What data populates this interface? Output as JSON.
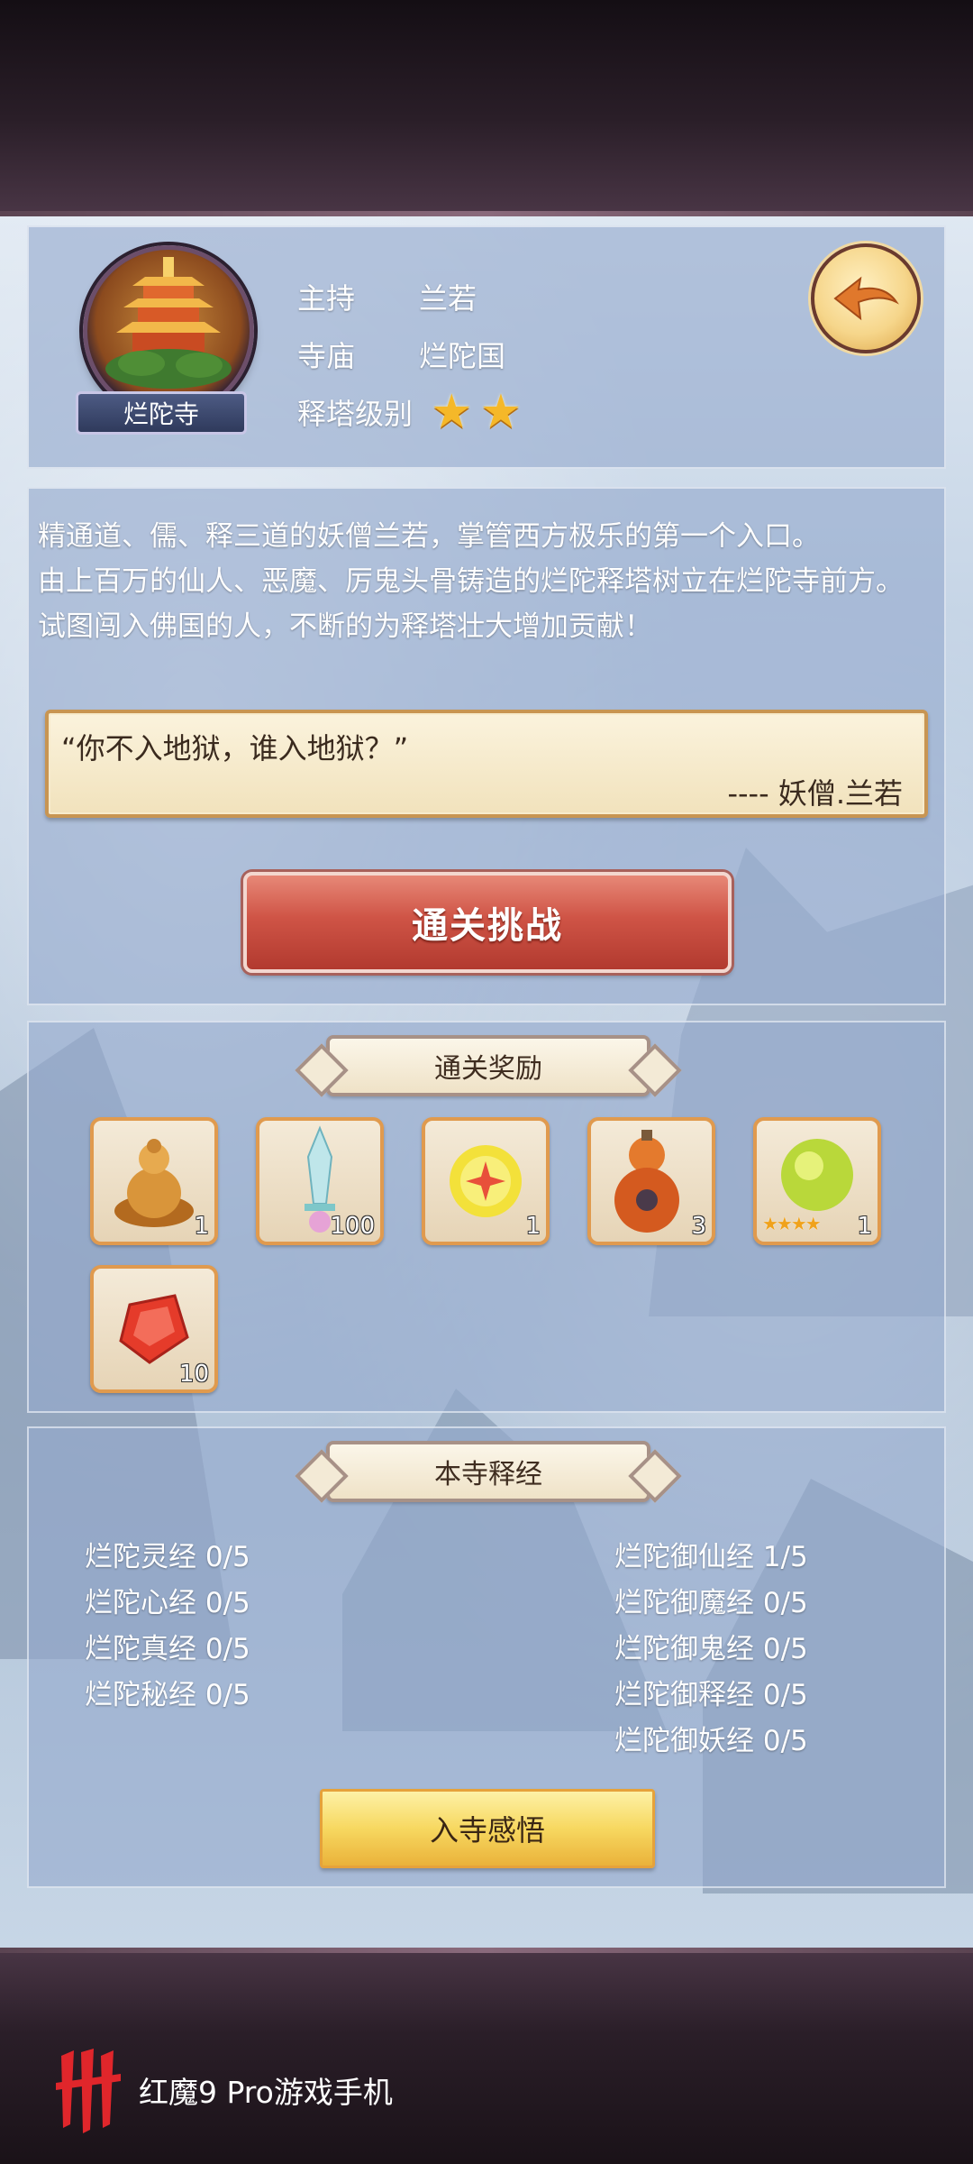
{
  "header": {
    "temple_badge": "烂陀寺",
    "rows": [
      {
        "label": "主持",
        "value": "兰若"
      },
      {
        "label": "寺庙",
        "value": "烂陀国"
      },
      {
        "label": "释塔级别",
        "value": ""
      }
    ],
    "tower_level_stars": 2,
    "back_icon": "back-arrow-icon"
  },
  "description": {
    "lines": [
      "精通道、儒、释三道的妖僧兰若，掌管西方极乐的第一个入口。",
      "由上百万的仙人、恶魔、厉鬼头骨铸造的烂陀释塔树立在烂陀寺前方。",
      "试图闯入佛国的人，不断的为释塔壮大增加贡献！"
    ],
    "quote": "“你不入地狱，谁入地狱？”",
    "quote_author": "---- 妖僧.兰若",
    "challenge_button": "通关挑战"
  },
  "rewards": {
    "title": "通关奖励",
    "items": [
      {
        "icon": "golden-buddha-icon",
        "count": "1"
      },
      {
        "icon": "jade-sword-icon",
        "count": "100"
      },
      {
        "icon": "golden-orb-icon",
        "count": "1"
      },
      {
        "icon": "gourd-icon",
        "count": "3"
      },
      {
        "icon": "green-orb-icon",
        "count": "1",
        "stars": 4
      },
      {
        "icon": "red-crystal-icon",
        "count": "10"
      }
    ]
  },
  "sutras": {
    "title": "本寺释经",
    "left": [
      "烂陀灵经 0/5",
      "烂陀心经 0/5",
      "烂陀真经 0/5",
      "烂陀秘经 0/5"
    ],
    "right": [
      "烂陀御仙经 1/5",
      "烂陀御魔经 0/5",
      "烂陀御鬼经 0/5",
      "烂陀御释经 0/5",
      "烂陀御妖经 0/5"
    ],
    "enter_button": "入寺感悟"
  },
  "brand": {
    "text": "红魔9 Pro游戏手机"
  },
  "colors": {
    "panel": "#94aacd",
    "challenge_red": "#cf5446",
    "gold": "#f5b829",
    "reward_border": "#e09a4e"
  }
}
